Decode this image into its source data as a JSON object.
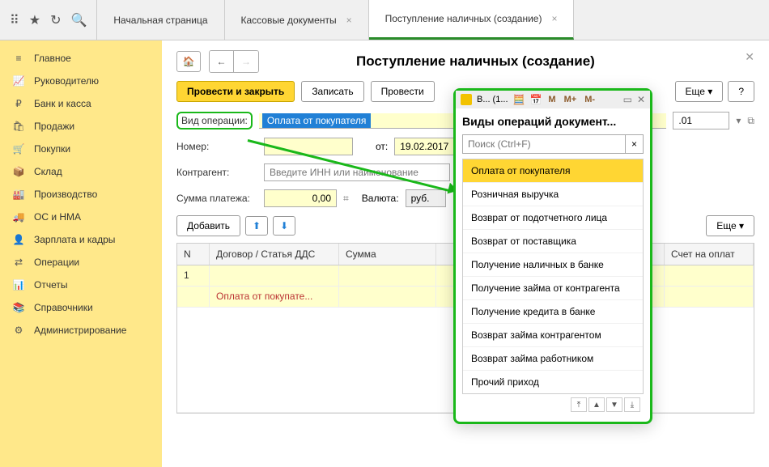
{
  "topbar": {
    "tabs": [
      {
        "label": "Начальная страница",
        "active": false,
        "closable": false
      },
      {
        "label": "Кассовые документы",
        "active": false,
        "closable": true
      },
      {
        "label": "Поступление наличных (создание)",
        "active": true,
        "closable": true
      }
    ]
  },
  "sidebar": {
    "items": [
      {
        "icon": "≡",
        "label": "Главное"
      },
      {
        "icon": "📈",
        "label": "Руководителю"
      },
      {
        "icon": "₽",
        "label": "Банк и касса"
      },
      {
        "icon": "🛍",
        "label": "Продажи"
      },
      {
        "icon": "🛒",
        "label": "Покупки"
      },
      {
        "icon": "📦",
        "label": "Склад"
      },
      {
        "icon": "🏭",
        "label": "Производство"
      },
      {
        "icon": "🚚",
        "label": "ОС и НМА"
      },
      {
        "icon": "👤",
        "label": "Зарплата и кадры"
      },
      {
        "icon": "⇄",
        "label": "Операции"
      },
      {
        "icon": "📊",
        "label": "Отчеты"
      },
      {
        "icon": "📚",
        "label": "Справочники"
      },
      {
        "icon": "⚙",
        "label": "Администрирование"
      }
    ]
  },
  "page": {
    "title": "Поступление наличных (создание)",
    "actions": {
      "post_close": "Провести и закрыть",
      "save": "Записать",
      "post": "Провести",
      "more": "Еще",
      "help": "?"
    },
    "form": {
      "operation_label": "Вид операции:",
      "operation_value": "Оплата от покупателя",
      "number_label": "Номер:",
      "date_label": "от:",
      "date_value": "19.02.2017  0:00",
      "counterparty_label": "Контрагент:",
      "counterparty_placeholder": "Введите ИНН или наименование",
      "sum_label": "Сумма платежа:",
      "sum_value": "0,00",
      "currency_label": "Валюта:",
      "currency_value": "руб.",
      "right_field_value": ".01"
    },
    "section": {
      "add": "Добавить",
      "more": "Еще"
    },
    "table": {
      "headers": {
        "n": "N",
        "contract": "Договор / Статья ДДС",
        "sum": "Сумма",
        "invoice": "Счет на оплат"
      },
      "rows": [
        {
          "n": "1",
          "contract": "",
          "sum": ""
        },
        {
          "n": "",
          "contract": "Оплата от покупате...",
          "sum": ""
        }
      ]
    }
  },
  "popup": {
    "titlebar": "В... (1...",
    "tools": [
      "M",
      "M+",
      "M-"
    ],
    "heading": "Виды операций документ...",
    "search_placeholder": "Поиск (Ctrl+F)",
    "options": [
      "Оплата от покупателя",
      "Розничная выручка",
      "Возврат от подотчетного лица",
      "Возврат от поставщика",
      "Получение наличных в банке",
      "Получение займа от контрагента",
      "Получение кредита в банке",
      "Возврат займа контрагентом",
      "Возврат займа работником",
      "Прочий приход"
    ],
    "selected_index": 0
  }
}
